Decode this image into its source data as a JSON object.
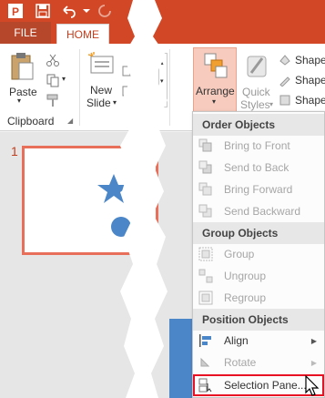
{
  "tabs": {
    "file": "FILE",
    "home": "HOME"
  },
  "ribbon": {
    "paste": "Paste",
    "new_slide_line1": "New",
    "new_slide_line2": "Slide",
    "clipboard_group": "Clipboard",
    "arrange": "Arrange",
    "quick_styles_line1": "Quick",
    "quick_styles_line2": "Styles",
    "shape_fill": "Shape",
    "shape_outline": "Shape",
    "shape_effects": "Shape"
  },
  "slide": {
    "number": "1"
  },
  "menu": {
    "headers": {
      "order": "Order Objects",
      "group": "Group Objects",
      "position": "Position Objects"
    },
    "order_items": [
      {
        "label": "Bring to Front",
        "icon": "bring-to-front-icon"
      },
      {
        "label": "Send to Back",
        "icon": "send-to-back-icon"
      },
      {
        "label": "Bring Forward",
        "icon": "bring-forward-icon"
      },
      {
        "label": "Send Backward",
        "icon": "send-backward-icon"
      }
    ],
    "group_items": [
      {
        "label": "Group",
        "icon": "group-icon"
      },
      {
        "label": "Ungroup",
        "icon": "ungroup-icon"
      },
      {
        "label": "Regroup",
        "icon": "regroup-icon"
      }
    ],
    "position_items": [
      {
        "label": "Align",
        "icon": "align-icon"
      },
      {
        "label": "Rotate",
        "icon": "rotate-icon"
      },
      {
        "label": "Selection Pane...",
        "icon": "selection-pane-icon"
      }
    ]
  },
  "colors": {
    "brand": "#d24726",
    "highlight_border": "#e81123",
    "shape_blue": "#4a86c8"
  }
}
